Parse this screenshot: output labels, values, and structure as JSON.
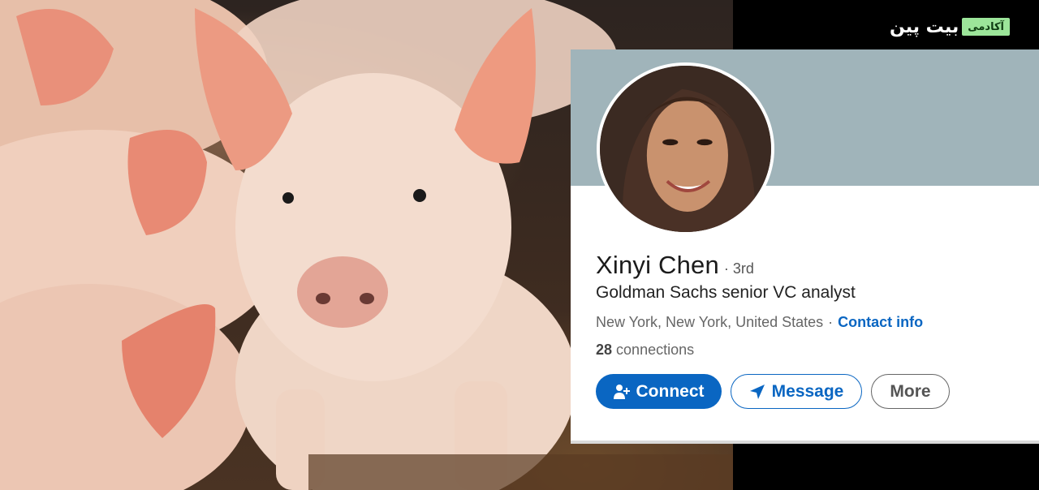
{
  "logo": {
    "badge": "آکادمی",
    "text": "بیت پین"
  },
  "profile": {
    "name": "Xinyi Chen",
    "degree": "· 3rd",
    "headline": "Goldman Sachs senior VC analyst",
    "location": "New York, New York, United States",
    "separator": "·",
    "contact_label": "Contact info",
    "connections_count": "28",
    "connections_label": "connections"
  },
  "actions": {
    "connect_label": "Connect",
    "message_label": "Message",
    "more_label": "More"
  },
  "colors": {
    "accent": "#0a66c2",
    "cover": "#a0b4ba",
    "logo_badge": "#9ce59a"
  },
  "icons": {
    "connect": "add-person-icon",
    "message": "paper-plane-icon"
  }
}
